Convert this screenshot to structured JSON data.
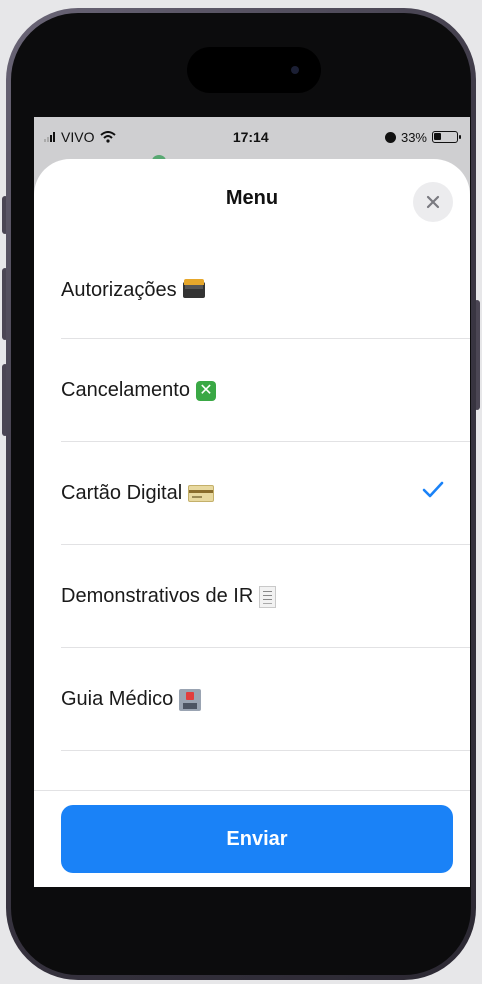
{
  "status_bar": {
    "carrier": "VIVO",
    "time": "17:14",
    "battery_percent": "33%"
  },
  "sheet": {
    "title": "Menu",
    "close_icon": "close-icon"
  },
  "menu": {
    "items": [
      {
        "label": "Autorizações",
        "emoji": "card-index-dividers-icon",
        "selected": false
      },
      {
        "label": "Cancelamento",
        "emoji": "cross-mark-button-icon",
        "selected": false
      },
      {
        "label": "Cartão Digital",
        "emoji": "credit-card-icon",
        "selected": true
      },
      {
        "label": "Demonstrativos de IR",
        "emoji": "receipt-icon",
        "selected": false
      },
      {
        "label": "Guia Médico",
        "emoji": "hospital-icon",
        "selected": false
      }
    ]
  },
  "footer": {
    "send_label": "Enviar"
  },
  "colors": {
    "accent": "#1a82f7",
    "checkmark": "#1a82f7",
    "sheet_bg": "#ffffff"
  }
}
